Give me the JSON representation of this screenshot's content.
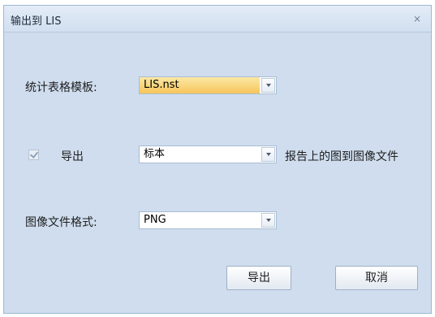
{
  "dialog": {
    "title": "输出到 LIS",
    "close_glyph": "⨯"
  },
  "template": {
    "label": "统计表格模板:",
    "value": "LIS.nst"
  },
  "export_row": {
    "checkbox_checked": true,
    "checkbox_label": "导出",
    "value": "标本",
    "suffix": "报告上的图到图像文件"
  },
  "image_format": {
    "label": "图像文件格式:",
    "value": "PNG"
  },
  "buttons": {
    "export": "导出",
    "cancel": "取消"
  }
}
